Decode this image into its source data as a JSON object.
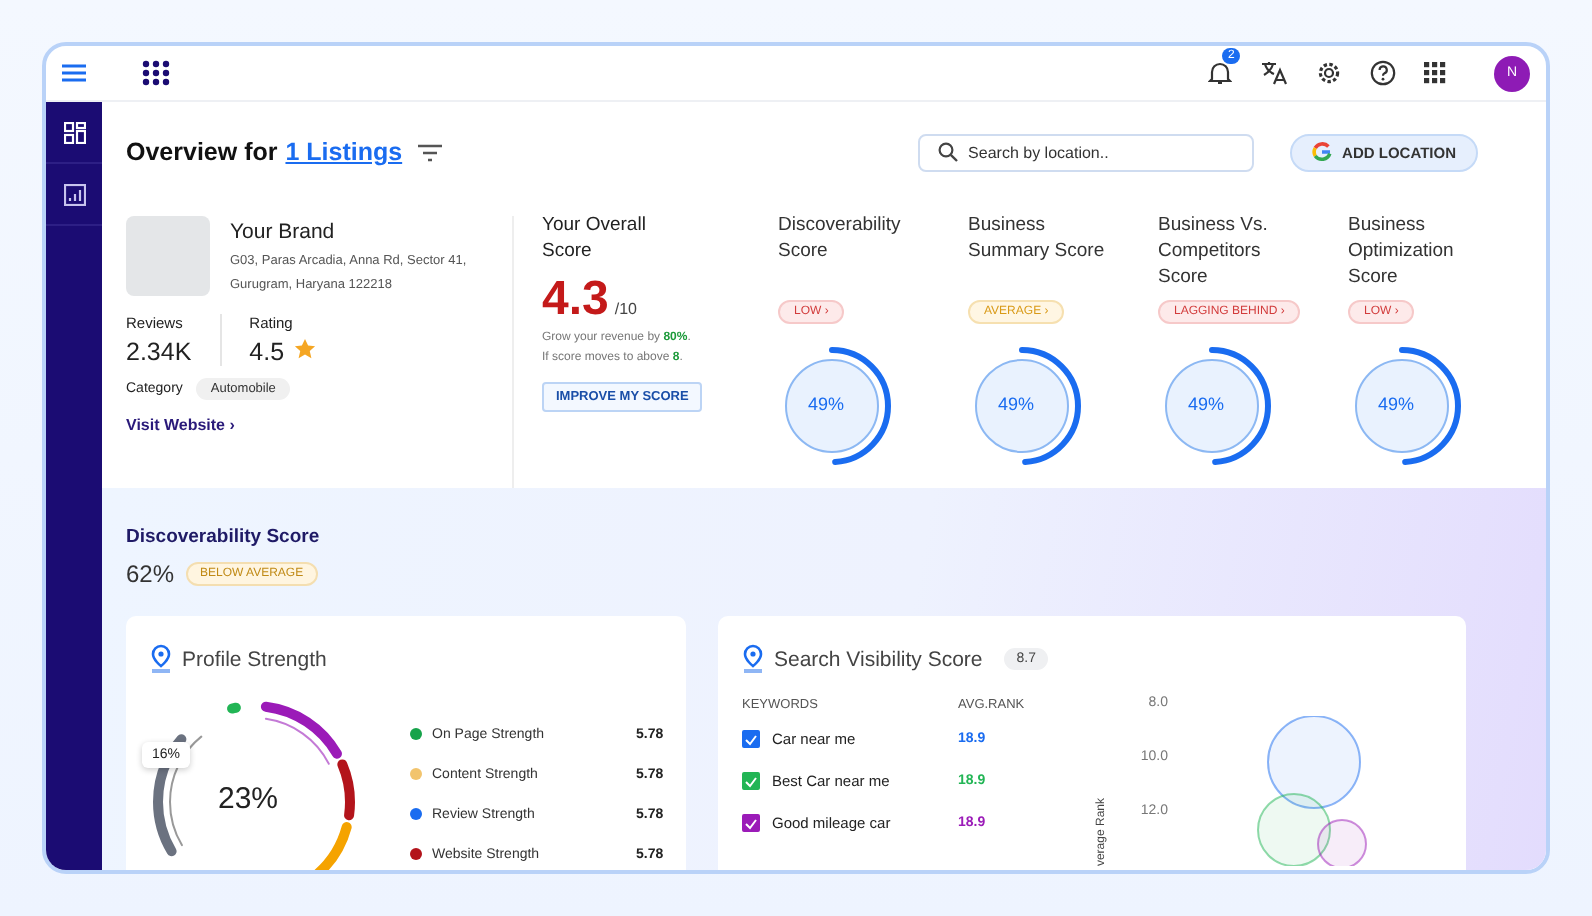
{
  "topbar": {
    "notification_count": "2",
    "avatar_initial": "N"
  },
  "header": {
    "title": "Overview for",
    "link": "1 Listings",
    "search": {
      "placeholder": "Search by location.."
    },
    "add_button": "ADD LOCATION"
  },
  "brand": {
    "name": "Your Brand",
    "address": "G03, Paras Arcadia, Anna Rd, Sector 41, Gurugram, Haryana 122218",
    "reviews_label": "Reviews",
    "reviews": "2.34K",
    "rating_label": "Rating",
    "rating": "4.5",
    "category_label": "Category",
    "category": "Automobile",
    "link": "Visit Website ›"
  },
  "overall": {
    "title": "Your Overall Score",
    "score": "4.3",
    "out_of": "/10",
    "note": "Grow your revenue by **80%**.",
    "note2": "If score moves to above **8**.",
    "button": "IMPROVE MY SCORE"
  },
  "scores": [
    {
      "title": "Discoverability Score",
      "badge": "LOW ›",
      "kind": "low",
      "value": "49%",
      "level": 0.49
    },
    {
      "title": "Business Summary Score",
      "badge": "AVERAGE ›",
      "kind": "average",
      "value": "49%",
      "level": 0.49
    },
    {
      "title": "Business Vs. Competitors Score",
      "badge": "LAGGING BEHIND ›",
      "kind": "low",
      "value": "49%",
      "level": 0.49
    },
    {
      "title": "Business Optimization Score",
      "badge": "LOW ›",
      "kind": "low",
      "value": "49%",
      "level": 0.49
    }
  ],
  "discoverability": {
    "title": "Discoverability Score",
    "value": "62%",
    "badge": "BELOW AVERAGE"
  },
  "profile_strength": {
    "title": "Profile Strength",
    "center": "23%",
    "tooltip": "16%",
    "items": [
      {
        "label": "On Page Strength",
        "value": "5.78",
        "color": "#16a34a"
      },
      {
        "label": "Content Strength",
        "value": "5.78",
        "color": "#f2c46d"
      },
      {
        "label": "Review Strength",
        "value": "5.78",
        "color": "#1a6cf0"
      },
      {
        "label": "Website Strength",
        "value": "5.78",
        "color": "#b3141b"
      }
    ]
  },
  "search_visibility": {
    "title": "Search Visibility Score",
    "score": "8.7",
    "columns": [
      "KEYWORDS",
      "AVG.RANK"
    ],
    "keywords": [
      {
        "label": "Car near me",
        "rank": "18.9",
        "checked": true,
        "color": "#1a6cf0"
      },
      {
        "label": "Best Car near me",
        "rank": "18.9",
        "checked": true,
        "color": "#22b555"
      },
      {
        "label": "Good mileage car",
        "rank": "18.9",
        "checked": true,
        "color": "#9b1bb8"
      }
    ],
    "chart_axis_label": "verage Rank",
    "chart_ticks": [
      "8.0",
      "10.0",
      "12.0"
    ]
  }
}
